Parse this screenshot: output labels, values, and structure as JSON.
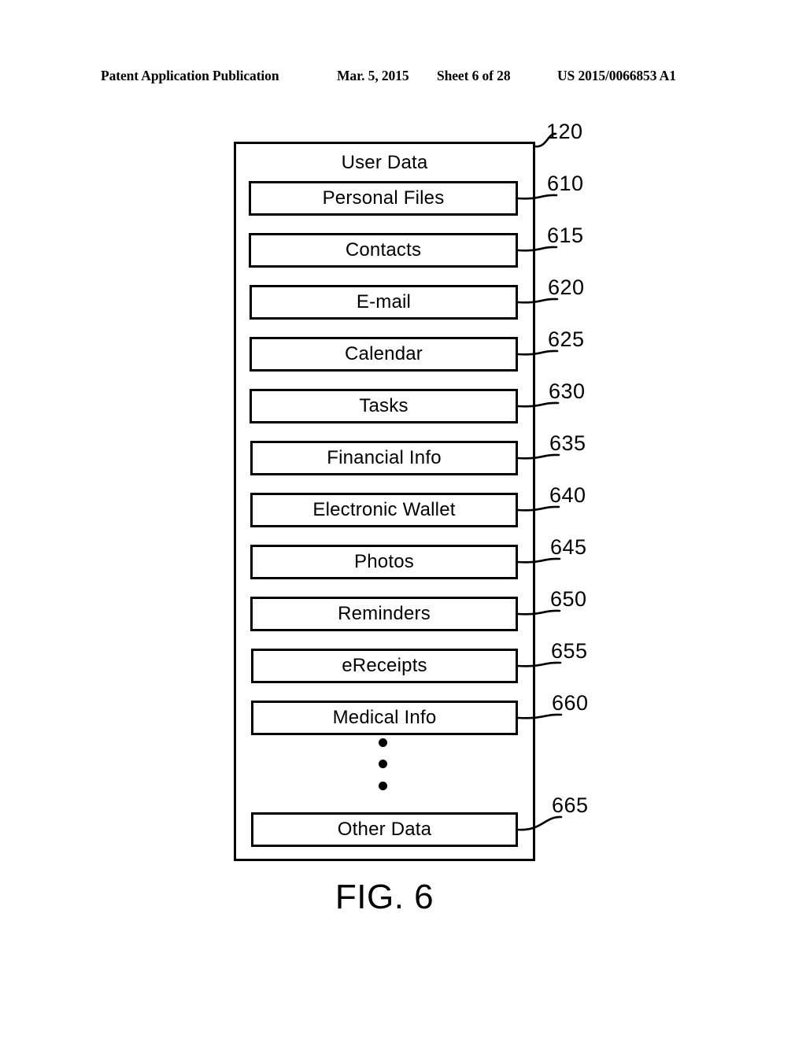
{
  "header": {
    "publication": "Patent Application Publication",
    "date": "Mar. 5, 2015",
    "sheet": "Sheet 6 of 28",
    "document_number": "US 2015/0066853 A1"
  },
  "figure": {
    "caption": "FIG. 6",
    "container": {
      "title": "User Data",
      "ref": "120"
    },
    "ellipsis_dots": 3,
    "items": [
      {
        "label": "Personal Files",
        "ref": "610"
      },
      {
        "label": "Contacts",
        "ref": "615"
      },
      {
        "label": "E-mail",
        "ref": "620"
      },
      {
        "label": "Calendar",
        "ref": "625"
      },
      {
        "label": "Tasks",
        "ref": "630"
      },
      {
        "label": "Financial Info",
        "ref": "635"
      },
      {
        "label": "Electronic Wallet",
        "ref": "640"
      },
      {
        "label": "Photos",
        "ref": "645"
      },
      {
        "label": "Reminders",
        "ref": "650"
      },
      {
        "label": "eReceipts",
        "ref": "655"
      },
      {
        "label": "Medical Info",
        "ref": "660"
      },
      {
        "label": "Other Data",
        "ref": "665"
      }
    ]
  },
  "colors": {
    "ink": "#000000",
    "paper": "#ffffff"
  }
}
